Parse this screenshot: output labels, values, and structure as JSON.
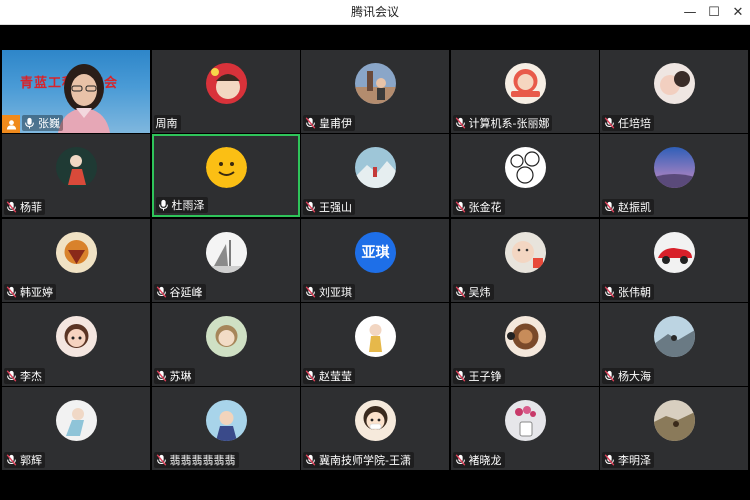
{
  "window": {
    "title": "腾讯会议",
    "min_symbol": "—",
    "max_symbol": "☐",
    "close_symbol": "✕"
  },
  "video": {
    "banner_text": "青蓝工程交流会",
    "host_icon": "person-icon"
  },
  "colors": {
    "active_border": "#2fc45a",
    "tile_bg": "#2e2f31",
    "muted_mic": "#e0405a",
    "host_badge": "#f08a1c",
    "banner_text": "#d8232a"
  },
  "participants": [
    {
      "name": "张巍",
      "mic": "active"
    },
    {
      "name": "周南",
      "mic": "none"
    },
    {
      "name": "皇甫伊",
      "mic": "muted"
    },
    {
      "name": "计算机系-张丽娜",
      "mic": "muted"
    },
    {
      "name": "任培培",
      "mic": "muted"
    },
    {
      "name": "杨菲",
      "mic": "muted"
    },
    {
      "name": "杜雨泽",
      "mic": "active",
      "speaking": true
    },
    {
      "name": "王强山",
      "mic": "muted"
    },
    {
      "name": "张金花",
      "mic": "muted"
    },
    {
      "name": "赵振凯",
      "mic": "muted"
    },
    {
      "name": "韩亚婷",
      "mic": "muted"
    },
    {
      "name": "谷延峰",
      "mic": "muted"
    },
    {
      "name": "刘亚琪",
      "mic": "muted",
      "avatar_text": "亚琪"
    },
    {
      "name": "吴炜",
      "mic": "muted"
    },
    {
      "name": "张伟朝",
      "mic": "muted"
    },
    {
      "name": "李杰",
      "mic": "muted"
    },
    {
      "name": "苏琳",
      "mic": "muted"
    },
    {
      "name": "赵莹莹",
      "mic": "muted"
    },
    {
      "name": "王子铮",
      "mic": "muted"
    },
    {
      "name": "杨大海",
      "mic": "muted"
    },
    {
      "name": "郭辉",
      "mic": "muted"
    },
    {
      "name": "翡翡翡翡翡翡",
      "mic": "muted"
    },
    {
      "name": "冀南技师学院-王潇",
      "mic": "muted"
    },
    {
      "name": "褚晓龙",
      "mic": "muted"
    },
    {
      "name": "李明泽",
      "mic": "muted"
    }
  ]
}
